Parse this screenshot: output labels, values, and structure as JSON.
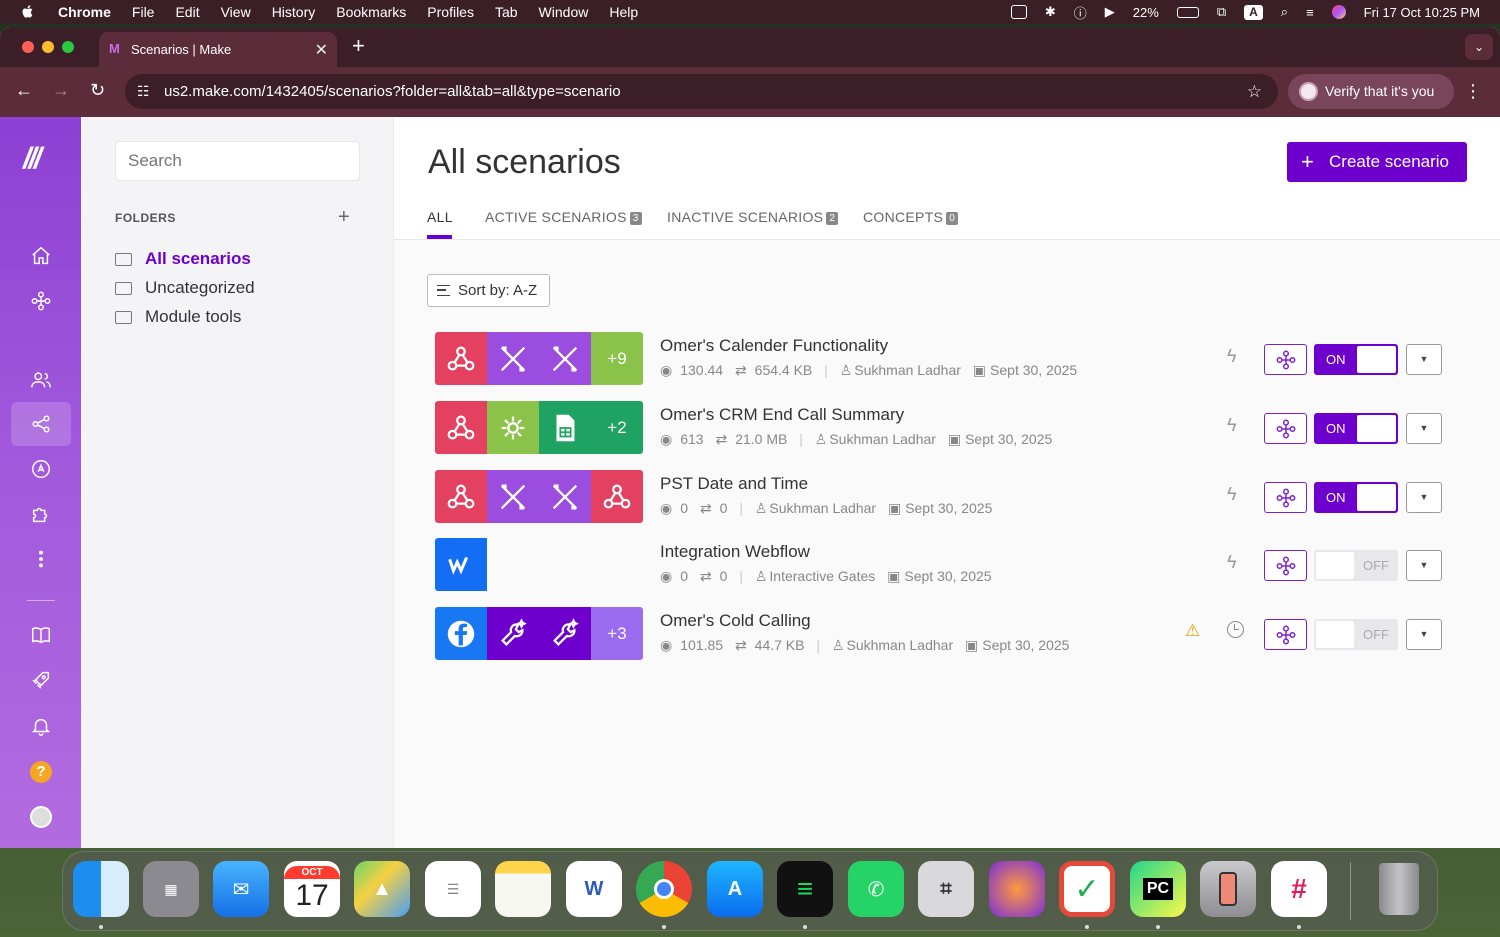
{
  "menubar": {
    "app": "Chrome",
    "items": [
      "File",
      "Edit",
      "View",
      "History",
      "Bookmarks",
      "Profiles",
      "Tab",
      "Window",
      "Help"
    ],
    "battery": "22%",
    "input_badge": "A",
    "datetime": "Fri 17 Oct  10:25 PM"
  },
  "browser": {
    "tab_title": "Scenarios | Make",
    "url": "us2.make.com/1432405/scenarios?folder=all&tab=all&type=scenario",
    "verify_label": "Verify that it's you"
  },
  "sidebar": {
    "search_placeholder": "Search",
    "folders_heading": "FOLDERS",
    "folders": [
      {
        "label": "All scenarios",
        "selected": true
      },
      {
        "label": "Uncategorized",
        "selected": false
      },
      {
        "label": "Module tools",
        "selected": false
      }
    ]
  },
  "rail": {
    "icons": [
      "home-icon",
      "scenarios-flow-icon",
      "team-icon",
      "share-icon",
      "ai-icon",
      "apps-puzzle-icon",
      "more-icon",
      "docs-book-icon",
      "rocket-icon",
      "notifications-bell-icon",
      "help-icon",
      "user-avatar"
    ]
  },
  "main": {
    "title": "All scenarios",
    "create_label": "Create scenario",
    "tabs": [
      {
        "label": "ALL",
        "count": null
      },
      {
        "label": "ACTIVE SCENARIOS",
        "count": "3"
      },
      {
        "label": "INACTIVE SCENARIOS",
        "count": "2"
      },
      {
        "label": "CONCEPTS",
        "count": "0"
      }
    ],
    "sort_label": "Sort by: A-Z",
    "scenarios": [
      {
        "name": "Omer's Calender Functionality",
        "ops": "130.44",
        "data": "654.4 KB",
        "owner": "Sukhman Ladhar",
        "date": "Sept 30, 2025",
        "state": "ON",
        "more": "+9"
      },
      {
        "name": "Omer's CRM End Call Summary",
        "ops": "613",
        "data": "21.0 MB",
        "owner": "Sukhman Ladhar",
        "date": "Sept 30, 2025",
        "state": "ON",
        "more": "+2"
      },
      {
        "name": "PST Date and Time",
        "ops": "0",
        "data": "0",
        "owner": "Sukhman Ladhar",
        "date": "Sept 30, 2025",
        "state": "ON",
        "more": ""
      },
      {
        "name": "Integration Webflow",
        "ops": "0",
        "data": "0",
        "owner": "Interactive Gates",
        "date": "Sept 30, 2025",
        "state": "OFF",
        "more": ""
      },
      {
        "name": "Omer's Cold Calling",
        "ops": "101.85",
        "data": "44.7 KB",
        "owner": "Sukhman Ladhar",
        "date": "Sept 30, 2025",
        "state": "OFF",
        "more": "+3"
      }
    ]
  },
  "dock": {
    "calendar_month": "OCT",
    "calendar_day": "17",
    "pycharm_label": "PC"
  },
  "colors": {
    "brand": "#6d00cc",
    "webhook": "#e4405f",
    "tools": "#9b4de0",
    "sheets_green": "#1ea362",
    "webflow": "#146ef5",
    "facebook": "#1877f2"
  }
}
